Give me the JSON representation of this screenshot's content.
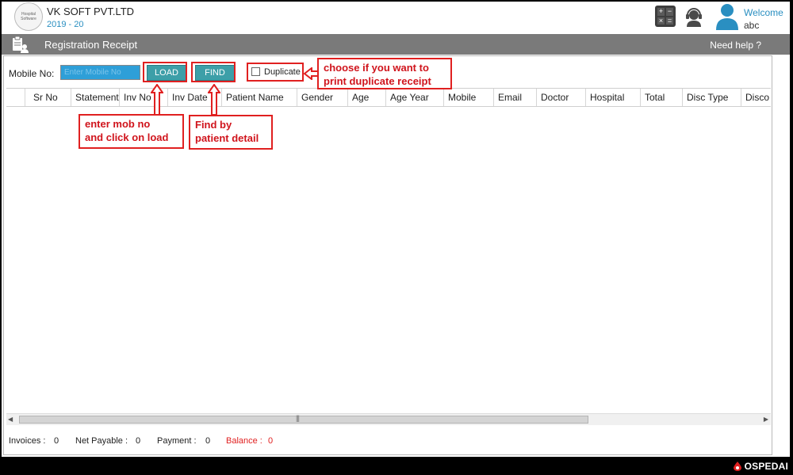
{
  "header": {
    "logo_text": "Hospital Software",
    "company": "VK SOFT PVT.LTD",
    "year": "2019 - 20",
    "welcome": "Welcome",
    "user": "abc",
    "calc_symbols": [
      "+",
      "−",
      "×",
      "="
    ]
  },
  "titlebar": {
    "title": "Registration Receipt",
    "help": "Need help ?"
  },
  "form": {
    "mobile_label": "Mobile No:",
    "mobile_placeholder": "Enter Mobile No",
    "load_label": "LOAD",
    "find_label": "FIND",
    "duplicate_label": "Duplicate"
  },
  "grid": {
    "columns": [
      "Sr No",
      "Statement",
      "Inv No",
      "Inv Date",
      "Patient Name",
      "Gender",
      "Age",
      "Age Year",
      "Mobile",
      "Email",
      "Doctor",
      "Hospital",
      "Total",
      "Disc Type",
      "Disco"
    ]
  },
  "totals": {
    "invoices_label": "Invoices :",
    "invoices_value": "0",
    "net_label": "Net Payable :",
    "net_value": "0",
    "payment_label": "Payment :",
    "payment_value": "0",
    "balance_label": "Balance :",
    "balance_value": "0"
  },
  "annotations": {
    "load_note_line1": "enter mob no",
    "load_note_line2": "and click on load",
    "find_note_line1": "Find by",
    "find_note_line2": "patient detail",
    "dup_note_line1": "choose if you want to",
    "dup_note_line2": "print duplicate receipt"
  },
  "brand": "OSPEDAI",
  "colors": {
    "accent_blue": "#2a8fc1",
    "button_teal": "#3d9fa8",
    "titlebar_gray": "#7a7a7a",
    "annotation_red": "#e02020"
  }
}
